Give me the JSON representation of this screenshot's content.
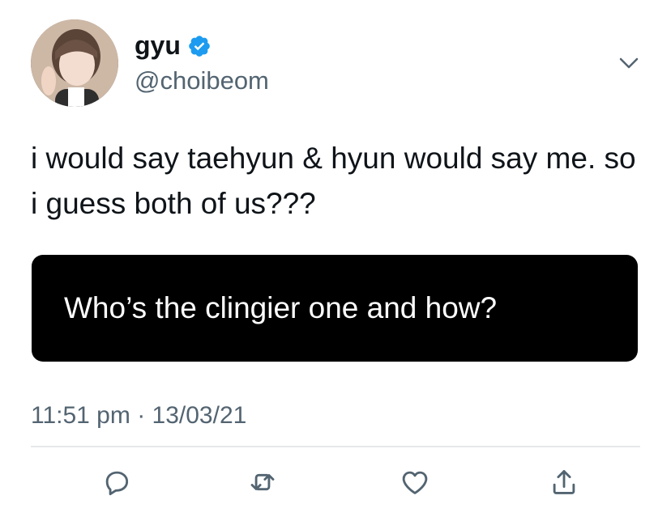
{
  "author": {
    "display_name": "gyu",
    "handle": "@choibeom",
    "verified": true
  },
  "tweet": {
    "text": "i would say taehyun & hyun would say me. so i guess both of us???",
    "card_text": "Who’s the clingier one and how?",
    "time": "11:51 pm",
    "separator": "·",
    "date": "13/03/21"
  },
  "icons": {
    "verified": "verified-badge-icon",
    "menu": "chevron-down-icon",
    "reply": "reply-icon",
    "retweet": "retweet-icon",
    "like": "heart-icon",
    "share": "share-icon"
  },
  "colors": {
    "text": "#0f1419",
    "secondary": "#536471",
    "verified": "#1d9bf0",
    "card_bg": "#000000"
  }
}
